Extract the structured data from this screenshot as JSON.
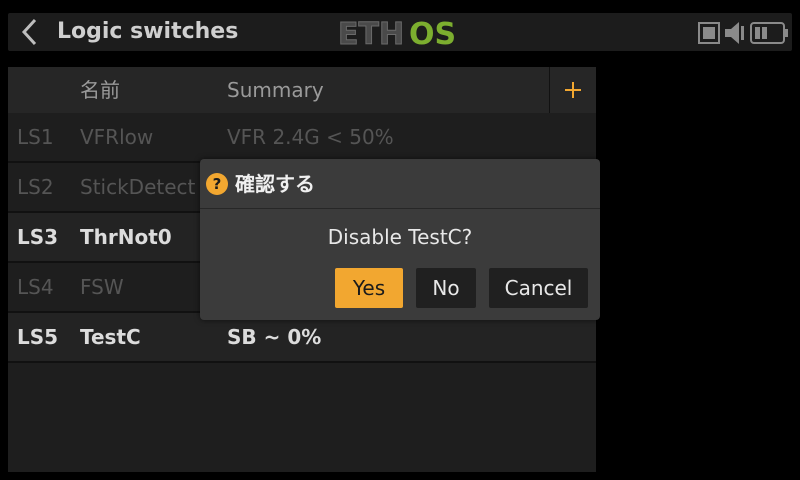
{
  "header": {
    "title": "Logic switches",
    "logo_left": "ETH",
    "logo_right": "OS",
    "back_icon": "chevron-left-icon"
  },
  "table": {
    "columns": {
      "name": "名前",
      "summary": "Summary"
    },
    "add_label": "+",
    "rows": [
      {
        "id": "LS1",
        "name": "VFRlow",
        "summary": "VFR 2.4G < 50%",
        "state": "disabled"
      },
      {
        "id": "LS2",
        "name": "StickDetect",
        "summary": "",
        "state": "disabled"
      },
      {
        "id": "LS3",
        "name": "ThrNot0",
        "summary": "",
        "state": "enabled"
      },
      {
        "id": "LS4",
        "name": "FSW",
        "summary": "",
        "state": "disabled"
      },
      {
        "id": "LS5",
        "name": "TestC",
        "summary": "SB ~ 0%",
        "state": "enabled"
      }
    ]
  },
  "dialog": {
    "icon": "question-icon",
    "icon_glyph": "?",
    "title": "確認する",
    "message": "Disable TestC?",
    "buttons": {
      "yes": "Yes",
      "no": "No",
      "cancel": "Cancel"
    }
  },
  "colors": {
    "accent": "#f2a730",
    "logo_green": "#7cae2f",
    "logo_gray": "#4a4a4a"
  }
}
